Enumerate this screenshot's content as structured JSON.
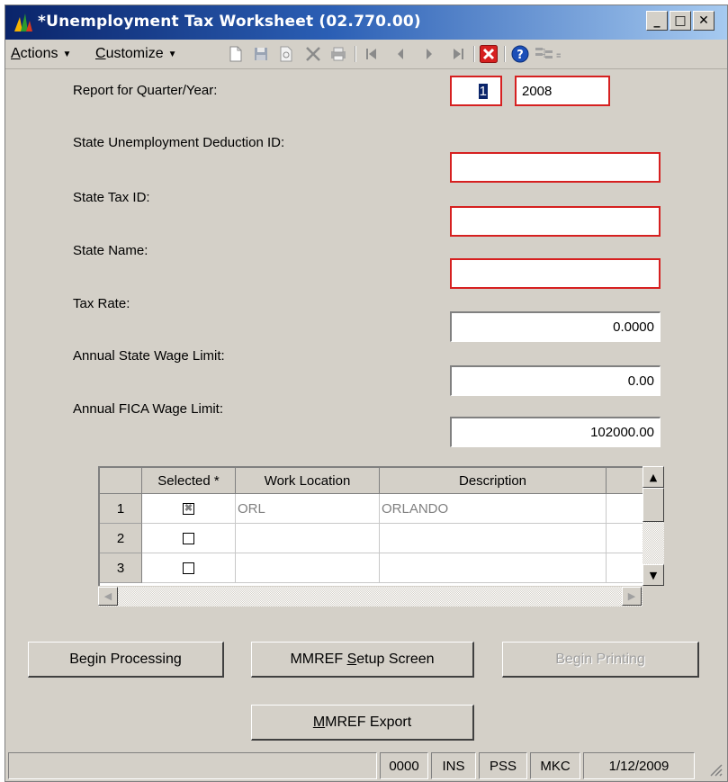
{
  "window": {
    "title": "*Unemployment Tax Worksheet (02.770.00)",
    "minimize_glyph": "_",
    "maximize_glyph": "□",
    "close_glyph": "✕"
  },
  "menu": {
    "actions_label": "Actions",
    "actions_mnemonic": "A",
    "customize_label": "Customize",
    "customize_mnemonic": "C",
    "caret": "▼"
  },
  "toolbar": {
    "icons": [
      "new-icon",
      "save-icon",
      "refresh-icon",
      "delete-icon",
      "print-icon",
      "first-icon",
      "previous-icon",
      "next-icon",
      "last-icon",
      "close-screen-icon",
      "help-icon",
      "tree-icon"
    ],
    "accent_close": "#d62020",
    "accent_help": "#1c4fb8"
  },
  "form": {
    "quarter_year_label": "Report for Quarter/Year:",
    "quarter_value": "1",
    "year_value": "2008",
    "deduction_id_label": "State Unemployment Deduction ID:",
    "deduction_id_value": "",
    "state_tax_id_label": "State Tax ID:",
    "state_tax_id_value": "",
    "state_name_label": "State Name:",
    "state_name_value": "",
    "tax_rate_label": "Tax Rate:",
    "tax_rate_value": "0.0000",
    "state_wage_limit_label": "Annual State Wage Limit:",
    "state_wage_limit_value": "0.00",
    "fica_wage_limit_label": "Annual FICA Wage Limit:",
    "fica_wage_limit_value": "102000.00",
    "required_color": "#d62020"
  },
  "grid": {
    "columns": [
      "Selected *",
      "Work Location",
      "Description"
    ],
    "rows": [
      {
        "num": "1",
        "selected": true,
        "location": "ORL",
        "description": "ORLANDO",
        "check_glyph": "✖"
      },
      {
        "num": "2",
        "selected": false,
        "location": "",
        "description": "",
        "check_glyph": ""
      },
      {
        "num": "3",
        "selected": false,
        "location": "",
        "description": "",
        "check_glyph": ""
      }
    ],
    "scroll_up": "▲",
    "scroll_down": "▼",
    "scroll_left": "◀",
    "scroll_right": "▶"
  },
  "buttons": {
    "begin_processing": "Begin Processing",
    "mmref_setup_prefix": "MMREF ",
    "mmref_setup_mnemonic": "S",
    "mmref_setup_rest": "etup Screen",
    "begin_printing": "Begin Printing",
    "mmref_export_mnemonic": "M",
    "mmref_export_rest": "MREF Export"
  },
  "status": {
    "message": "",
    "code": "0000",
    "mode": "INS",
    "db": "PSS",
    "company": "MKC",
    "date": "1/12/2009"
  }
}
